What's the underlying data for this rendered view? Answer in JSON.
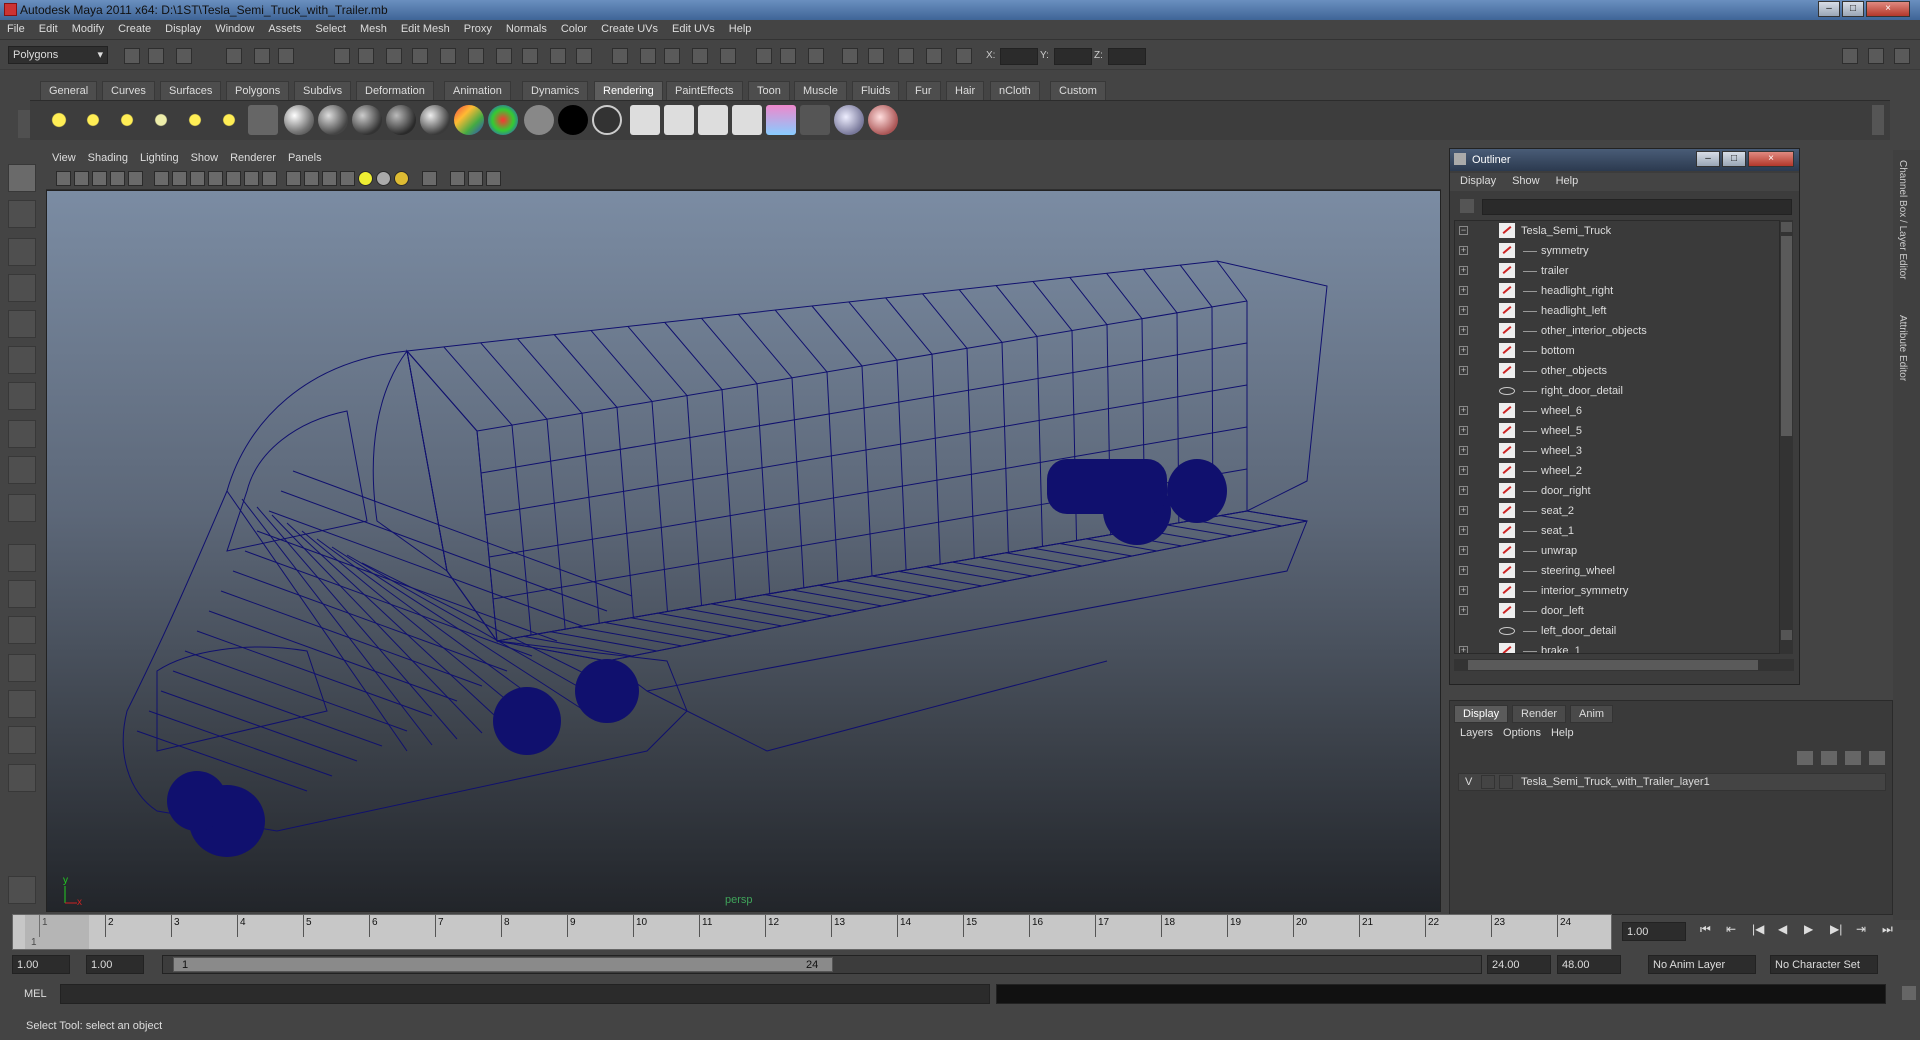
{
  "window": {
    "title": "Autodesk Maya 2011 x64: D:\\1ST\\Tesla_Semi_Truck_with_Trailer.mb",
    "controls": [
      "–",
      "□",
      "×"
    ]
  },
  "menubar": [
    "File",
    "Edit",
    "Modify",
    "Create",
    "Display",
    "Window",
    "Assets",
    "Select",
    "Mesh",
    "Edit Mesh",
    "Proxy",
    "Normals",
    "Color",
    "Create UVs",
    "Edit UVs",
    "Help"
  ],
  "statusline": {
    "mode": "Polygons",
    "x_label": "X:",
    "y_label": "Y:",
    "z_label": "Z:"
  },
  "shelf": {
    "tabs": [
      "General",
      "Curves",
      "Surfaces",
      "Polygons",
      "Subdivs",
      "Deformation",
      "Animation",
      "Dynamics",
      "Rendering",
      "PaintEffects",
      "Toon",
      "Muscle",
      "Fluids",
      "Fur",
      "Hair",
      "nCloth",
      "Custom"
    ],
    "active_tab": "Rendering",
    "icons": [
      "ambient-light-icon",
      "directional-light-icon",
      "point-light-icon",
      "spot-light-icon",
      "area-light-icon",
      "volume-light-icon",
      "camera-icon",
      "blinn-icon",
      "lambert-icon",
      "phong-icon",
      "phonge-icon",
      "anisotropic-icon",
      "ramp-icon",
      "rainbow-icon",
      "layered-icon",
      "black-sphere-icon",
      "outline-sphere-icon",
      "render-icon",
      "ipr-render-icon",
      "render-settings-icon",
      "hypershade-icon",
      "render-view-icon",
      "batch-render-icon",
      "paint-icon",
      "brush-icon"
    ]
  },
  "viewport": {
    "menu": [
      "View",
      "Shading",
      "Lighting",
      "Show",
      "Renderer",
      "Panels"
    ],
    "camera": "persp",
    "wire_color": "#10106e"
  },
  "outliner": {
    "title": "Outliner",
    "menu": [
      "Display",
      "Show",
      "Help"
    ],
    "items": [
      {
        "label": "Tesla_Semi_Truck",
        "level": 0,
        "expanded": true,
        "kind": "mesh"
      },
      {
        "label": "symmetry",
        "level": 1,
        "kind": "mesh"
      },
      {
        "label": "trailer",
        "level": 1,
        "kind": "mesh"
      },
      {
        "label": "headlight_right",
        "level": 1,
        "kind": "mesh"
      },
      {
        "label": "headlight_left",
        "level": 1,
        "kind": "mesh"
      },
      {
        "label": "other_interior_objects",
        "level": 1,
        "kind": "mesh"
      },
      {
        "label": "bottom",
        "level": 1,
        "kind": "mesh"
      },
      {
        "label": "other_objects",
        "level": 1,
        "kind": "mesh"
      },
      {
        "label": "right_door_detail",
        "level": 1,
        "kind": "locator"
      },
      {
        "label": "wheel_6",
        "level": 1,
        "kind": "mesh"
      },
      {
        "label": "wheel_5",
        "level": 1,
        "kind": "mesh"
      },
      {
        "label": "wheel_3",
        "level": 1,
        "kind": "mesh"
      },
      {
        "label": "wheel_2",
        "level": 1,
        "kind": "mesh"
      },
      {
        "label": "door_right",
        "level": 1,
        "kind": "mesh"
      },
      {
        "label": "seat_2",
        "level": 1,
        "kind": "mesh"
      },
      {
        "label": "seat_1",
        "level": 1,
        "kind": "mesh"
      },
      {
        "label": "unwrap",
        "level": 1,
        "kind": "mesh"
      },
      {
        "label": "steering_wheel",
        "level": 1,
        "kind": "mesh"
      },
      {
        "label": "interior_symmetry",
        "level": 1,
        "kind": "mesh"
      },
      {
        "label": "door_left",
        "level": 1,
        "kind": "mesh"
      },
      {
        "label": "left_door_detail",
        "level": 1,
        "kind": "locator"
      },
      {
        "label": "brake_1",
        "level": 1,
        "kind": "mesh"
      }
    ]
  },
  "layers": {
    "tabs": [
      "Display",
      "Render",
      "Anim"
    ],
    "active_tab": "Display",
    "menu": [
      "Layers",
      "Options",
      "Help"
    ],
    "layer": {
      "visible": "V",
      "name": "Tesla_Semi_Truck_with_Trailer_layer1"
    }
  },
  "timeline": {
    "frames": [
      "1",
      "2",
      "3",
      "4",
      "5",
      "6",
      "7",
      "8",
      "9",
      "10",
      "11",
      "12",
      "13",
      "14",
      "15",
      "16",
      "17",
      "18",
      "19",
      "20",
      "21",
      "22",
      "23",
      "24"
    ],
    "current_frame": "1",
    "current_time_field": "1.00",
    "range_start": "1.00",
    "range_start2": "1.00",
    "slider_start": "1",
    "slider_end": "24",
    "range_end": "24.00",
    "range_end2": "48.00",
    "anim_layer": "No Anim Layer",
    "character_set": "No Character Set"
  },
  "command_line": {
    "label": "MEL"
  },
  "help_line": "Select Tool: select an object",
  "right_tabs": [
    "Channel Box / Layer Editor",
    "Attribute Editor"
  ]
}
